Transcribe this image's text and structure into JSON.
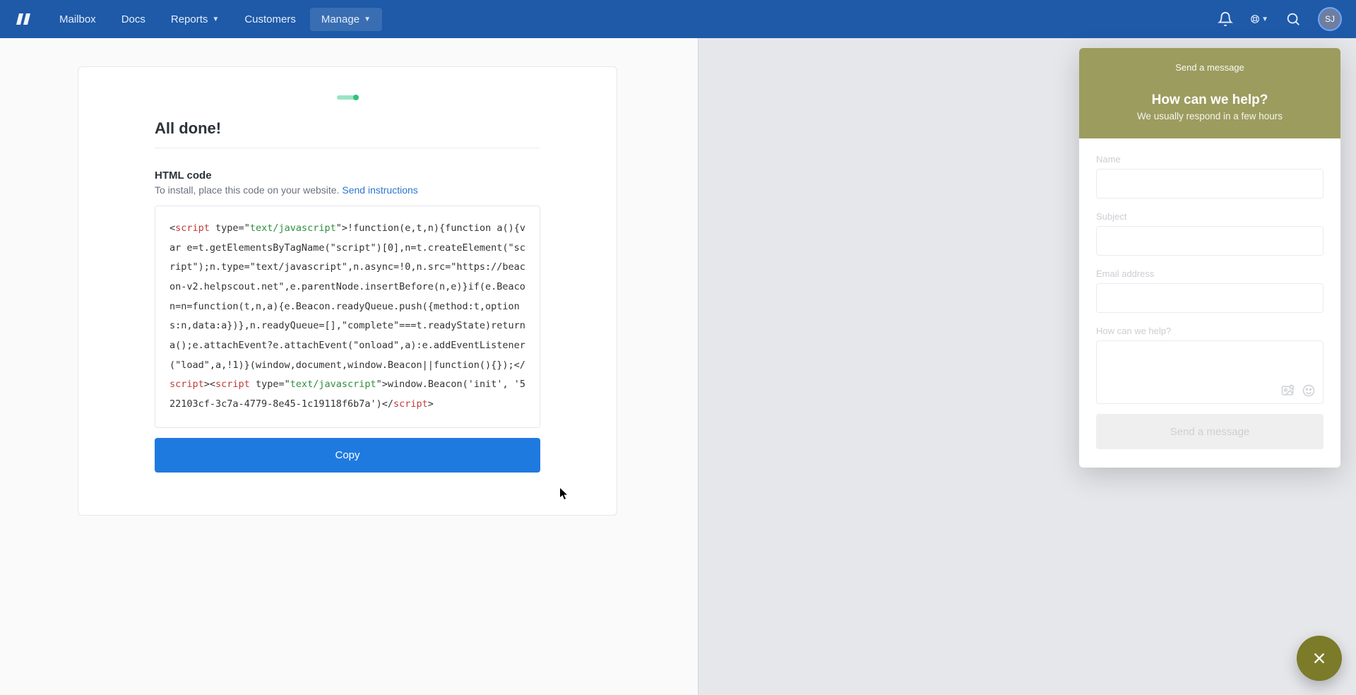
{
  "nav": {
    "items": [
      {
        "label": "Mailbox"
      },
      {
        "label": "Docs"
      },
      {
        "label": "Reports",
        "dropdown": true
      },
      {
        "label": "Customers"
      },
      {
        "label": "Manage",
        "dropdown": true,
        "active": true
      }
    ]
  },
  "avatar": {
    "initials": "SJ"
  },
  "card": {
    "title": "All done!",
    "section_label": "HTML code",
    "subtext_prefix": "To install, place this code on your website. ",
    "subtext_link": "Send instructions",
    "copy_label": "Copy",
    "code": {
      "open_tag": "script",
      "type_attr": " type=\"",
      "type_val": "text/javascript",
      "type_close": "\">",
      "body1": "!function(e,t,n){function a(){var e=t.getElementsByTagName(\"script\")[0],n=t.createElement(\"script\");n.type=\"text/javascript\",n.async=!0,n.src=\"https://beacon-v2.helpscout.net\",e.parentNode.insertBefore(n,e)}if(e.Beacon=n=function(t,n,a){e.Beacon.readyQueue.push({method:t,options:n,data:a})},n.readyQueue=[],\"complete\"===t.readyState)return a();e.attachEvent?e.attachEvent(\"onload\",a):e.addEventListener(\"load\",a,!1)}(window,document,window.Beacon||function(){});",
      "close1": "script",
      "mid": "><",
      "open2": "script",
      "body2": "window.Beacon('init', '522103cf-3c7a-4779-8e45-1c19118f6b7a')",
      "close2": "script",
      "gt": ">",
      "lt_slash": "</",
      "lt": "<"
    }
  },
  "beacon": {
    "header_small": "Send a message",
    "header_big": "How can we help?",
    "header_sub": "We usually respond in a few hours",
    "fields": {
      "name": "Name",
      "subject": "Subject",
      "email": "Email address",
      "message": "How can we help?"
    },
    "send_label": "Send a message"
  }
}
